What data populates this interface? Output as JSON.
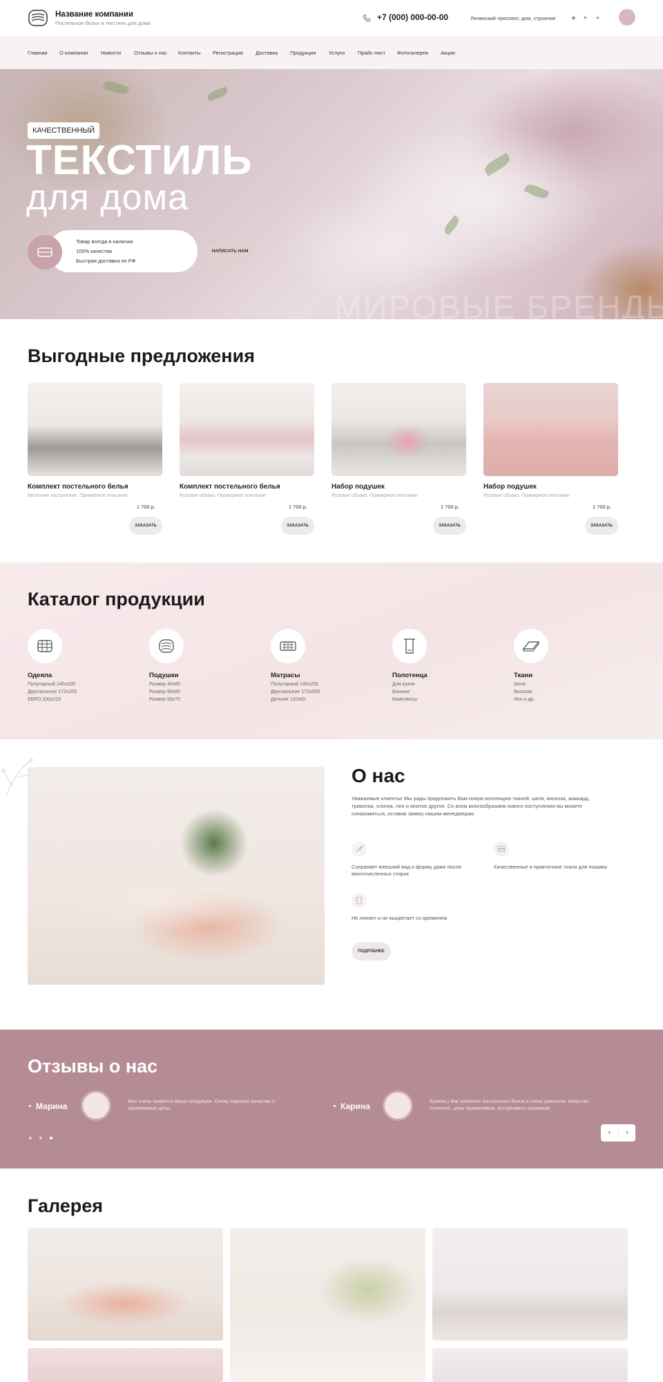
{
  "header": {
    "company_name": "Название компании",
    "company_sub": "Постельное белье и текстиль для дома",
    "phone": "+7 (000) 000-00-00",
    "address": "Ленинский проспект, дом, строение"
  },
  "nav": {
    "items": [
      "Главная",
      "О компании",
      "Новости",
      "Отзывы о нас",
      "Контакты",
      "Регистрация",
      "Доставка",
      "Продукция",
      "Услуги",
      "Прайс-лист",
      "Фотогалерея",
      "Акции"
    ]
  },
  "hero": {
    "badge": "КАЧЕСТВЕННЫЙ",
    "title": "ТЕКСТИЛЬ",
    "subtitle": "для дома",
    "features": [
      "Товар всегда в наличии",
      "100% качества",
      "Быстрая доставка по РФ"
    ],
    "button": "НАПИСАТЬ НАМ",
    "brands": "МИРОВЫЕ БРЕНДЫ"
  },
  "offers": {
    "title": "Выгодные предложения",
    "items": [
      {
        "name": "Комплект постельного белья",
        "desc": "Весенние настроение. Примерное описание",
        "price": "1 700 р.",
        "button": "ЗАКАЗАТЬ"
      },
      {
        "name": "Комплект постельного белья",
        "desc": "Розовое облако. Примерное описание",
        "price": "1 700 р.",
        "button": "ЗАКАЗАТЬ"
      },
      {
        "name": "Набор подушек",
        "desc": "Розовое облако. Примерное описание",
        "price": "1 700 р.",
        "button": "ЗАКАЗАТЬ"
      },
      {
        "name": "Набор подушек",
        "desc": "Розовое облако. Примерное описание",
        "price": "1 700 р.",
        "button": "ЗАКАЗАТЬ"
      }
    ]
  },
  "catalog": {
    "title": "Каталог продукции",
    "items": [
      {
        "name": "Одеяла",
        "lines": [
          "Полуторный 140х205",
          "Двуспальное 172х205",
          "ЕВРО 200х220"
        ],
        "icon": "blanket-icon"
      },
      {
        "name": "Подушки",
        "lines": [
          "Размер 40х60",
          "Размер 60х60",
          "Размер 50х70"
        ],
        "icon": "pillow-icon"
      },
      {
        "name": "Матрасы",
        "lines": [
          "Полуторный 140х205",
          "Двуспальное 172х205",
          "Детские 110х60"
        ],
        "icon": "mattress-icon"
      },
      {
        "name": "Полотенца",
        "lines": [
          "Для кухни",
          "Банные",
          "Комплекты"
        ],
        "icon": "towel-icon"
      },
      {
        "name": "Ткани",
        "lines": [
          "Шелк",
          "Вискоза",
          "Лен и др."
        ],
        "icon": "fabric-icon"
      }
    ]
  },
  "about": {
    "title": "О нас",
    "text": "Уважаемые клиенты! Мы рады предложить Вам новую коллекцию тканей: шелк, вискоза, жаккард, трикотаж, хлопок, лен и многое другое. Со всем многообразием нового поступления вы можете ознакомиться, оставив заявку нашим менеджерам.",
    "features": [
      "Сохраняет внешний вид и форму даже после многочисленных стирок",
      "Качественные и практичные ткани для пошива",
      "Не линяет и не выцветает со временем"
    ],
    "button": "ПОДРОБНЕЕ"
  },
  "reviews": {
    "title": "Отзывы о нас",
    "items": [
      {
        "name": "Марина",
        "text": "Мне очень нравится Ваша продукция. Очень хорошее качество и приемлемые цены."
      },
      {
        "name": "Карина",
        "text": "Купила у Вас комплект постельного белья и очень довольна. Качество отличное, цены приемлемые, ассортимент огромный."
      }
    ],
    "prev": "‹",
    "next": "›"
  },
  "gallery": {
    "title": "Галерея"
  },
  "colors": {
    "accent": "#b58b96",
    "nav_bg": "#f8f3f3",
    "catalog_bg": "#f6e8ea"
  }
}
